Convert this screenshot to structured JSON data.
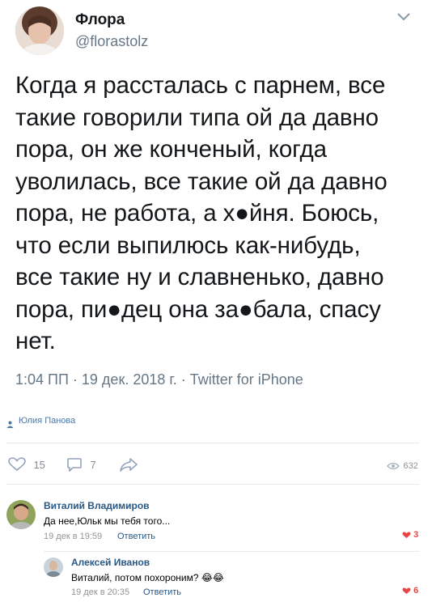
{
  "tweet": {
    "display_name": "Флора",
    "handle": "@florastolz",
    "text": "Когда я рассталась с парнем, все\nтакие говорили типа ой да давно\nпора, он же конченый, когда\nуволилась, все такие ой да давно\nпора, не работа, а х●йня. Боюсь,\nчто если выпилюсь как-нибудь,\nвсе такие ну и славненько, давно\nпора, пи●дец она за●бала, спасу\nнет.",
    "meta": "1:04 ПП · 19 дек. 2018 г. · Twitter for iPhone"
  },
  "post": {
    "author": "Юлия Панова",
    "likes": "15",
    "reposts": "7",
    "views": "632"
  },
  "comments": [
    {
      "name": "Виталий Владимиров",
      "text": "Да нее,Юльк мы тебя того...",
      "date": "19 дек в 19:59",
      "reply_label": "Ответить",
      "likes": "3"
    },
    {
      "name": "Алексей Иванов",
      "text": "Виталий, потом похороним? 😂😂",
      "date": "19 дек в 20:35",
      "reply_label": "Ответить",
      "likes": "6"
    }
  ],
  "colors": {
    "link": "#2a5885",
    "meta": "#657786",
    "like_red": "#e64646"
  }
}
